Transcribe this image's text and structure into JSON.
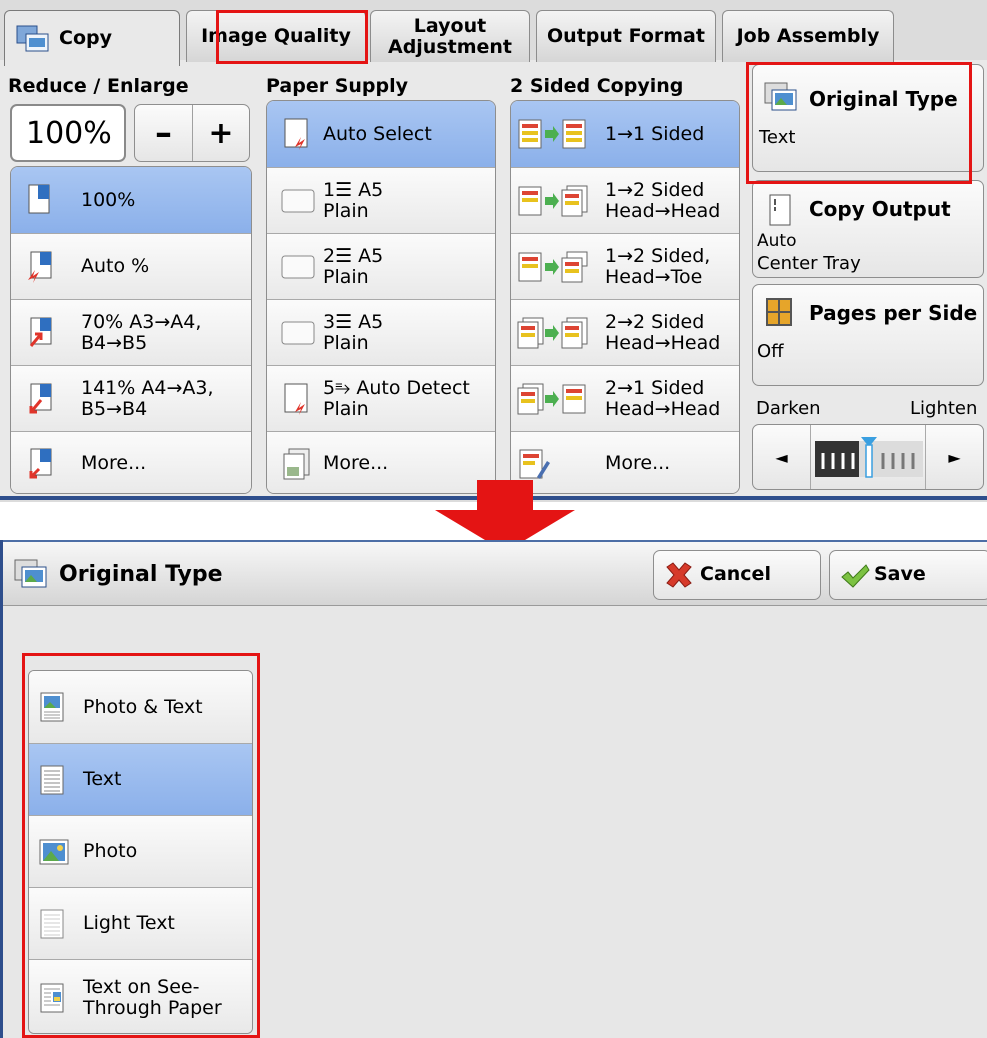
{
  "copy_screen": {
    "tabs": [
      {
        "label": "Copy"
      },
      {
        "label": "Image Quality"
      },
      {
        "label_line1": "Layout",
        "label_line2": "Adjustment"
      },
      {
        "label": "Output Format"
      },
      {
        "label": "Job Assembly"
      }
    ],
    "reduce_enlarge": {
      "label": "Reduce / Enlarge",
      "value": "100%",
      "minus": "–",
      "plus": "+",
      "options": [
        {
          "line1": "100%",
          "line2": "",
          "selected": true
        },
        {
          "line1": "Auto %",
          "line2": "",
          "selected": false
        },
        {
          "line1": "70% A3→A4,",
          "line2": "B4→B5",
          "selected": false
        },
        {
          "line1": "141% A4→A3,",
          "line2": "B5→B4",
          "selected": false
        },
        {
          "line1": "More...",
          "line2": "",
          "selected": false
        }
      ]
    },
    "paper_supply": {
      "label": "Paper Supply",
      "options": [
        {
          "line1": "Auto Select",
          "line2": "",
          "selected": true
        },
        {
          "line1": "1☰ A5",
          "line2": "Plain",
          "selected": false
        },
        {
          "line1": "2☰ A5",
          "line2": "Plain",
          "selected": false
        },
        {
          "line1": "3☰ A5",
          "line2": "Plain",
          "selected": false
        },
        {
          "line1": "5⥱ Auto Detect",
          "line2": "Plain",
          "selected": false
        },
        {
          "line1": "More...",
          "line2": "",
          "selected": false
        }
      ]
    },
    "two_sided": {
      "label": "2 Sided Copying",
      "options": [
        {
          "line1": "1→1 Sided",
          "line2": "",
          "selected": true
        },
        {
          "line1": "1→2 Sided",
          "line2": "Head→Head",
          "selected": false
        },
        {
          "line1": "1→2 Sided,",
          "line2": "Head→Toe",
          "selected": false
        },
        {
          "line1": "2→2 Sided",
          "line2": "Head→Head",
          "selected": false
        },
        {
          "line1": "2→1 Sided",
          "line2": "Head→Head",
          "selected": false
        },
        {
          "line1": "More...",
          "line2": "",
          "selected": false
        }
      ]
    },
    "original_type": {
      "label": "Original Type",
      "value": "Text"
    },
    "copy_output": {
      "label": "Copy Output",
      "value_line1": "Auto",
      "value_line2": "Center Tray"
    },
    "pages_per_side": {
      "label": "Pages per Side",
      "value": "Off"
    },
    "density": {
      "darken": "Darken",
      "lighten": "Lighten",
      "left_arrow": "◄",
      "right_arrow": "►"
    }
  },
  "original_type_screen": {
    "title": "Original Type",
    "cancel": "Cancel",
    "save": "Save",
    "options": [
      {
        "line1": "Photo & Text",
        "line2": "",
        "selected": false
      },
      {
        "line1": "Text",
        "line2": "",
        "selected": true
      },
      {
        "line1": "Photo",
        "line2": "",
        "selected": false
      },
      {
        "line1": "Light Text",
        "line2": "",
        "selected": false
      },
      {
        "line1": "Text on See-",
        "line2": "Through Paper",
        "selected": false
      }
    ]
  },
  "colors": {
    "highlight": "#e41414",
    "selected": "#9bbcef",
    "frame": "#2e4e8c"
  }
}
